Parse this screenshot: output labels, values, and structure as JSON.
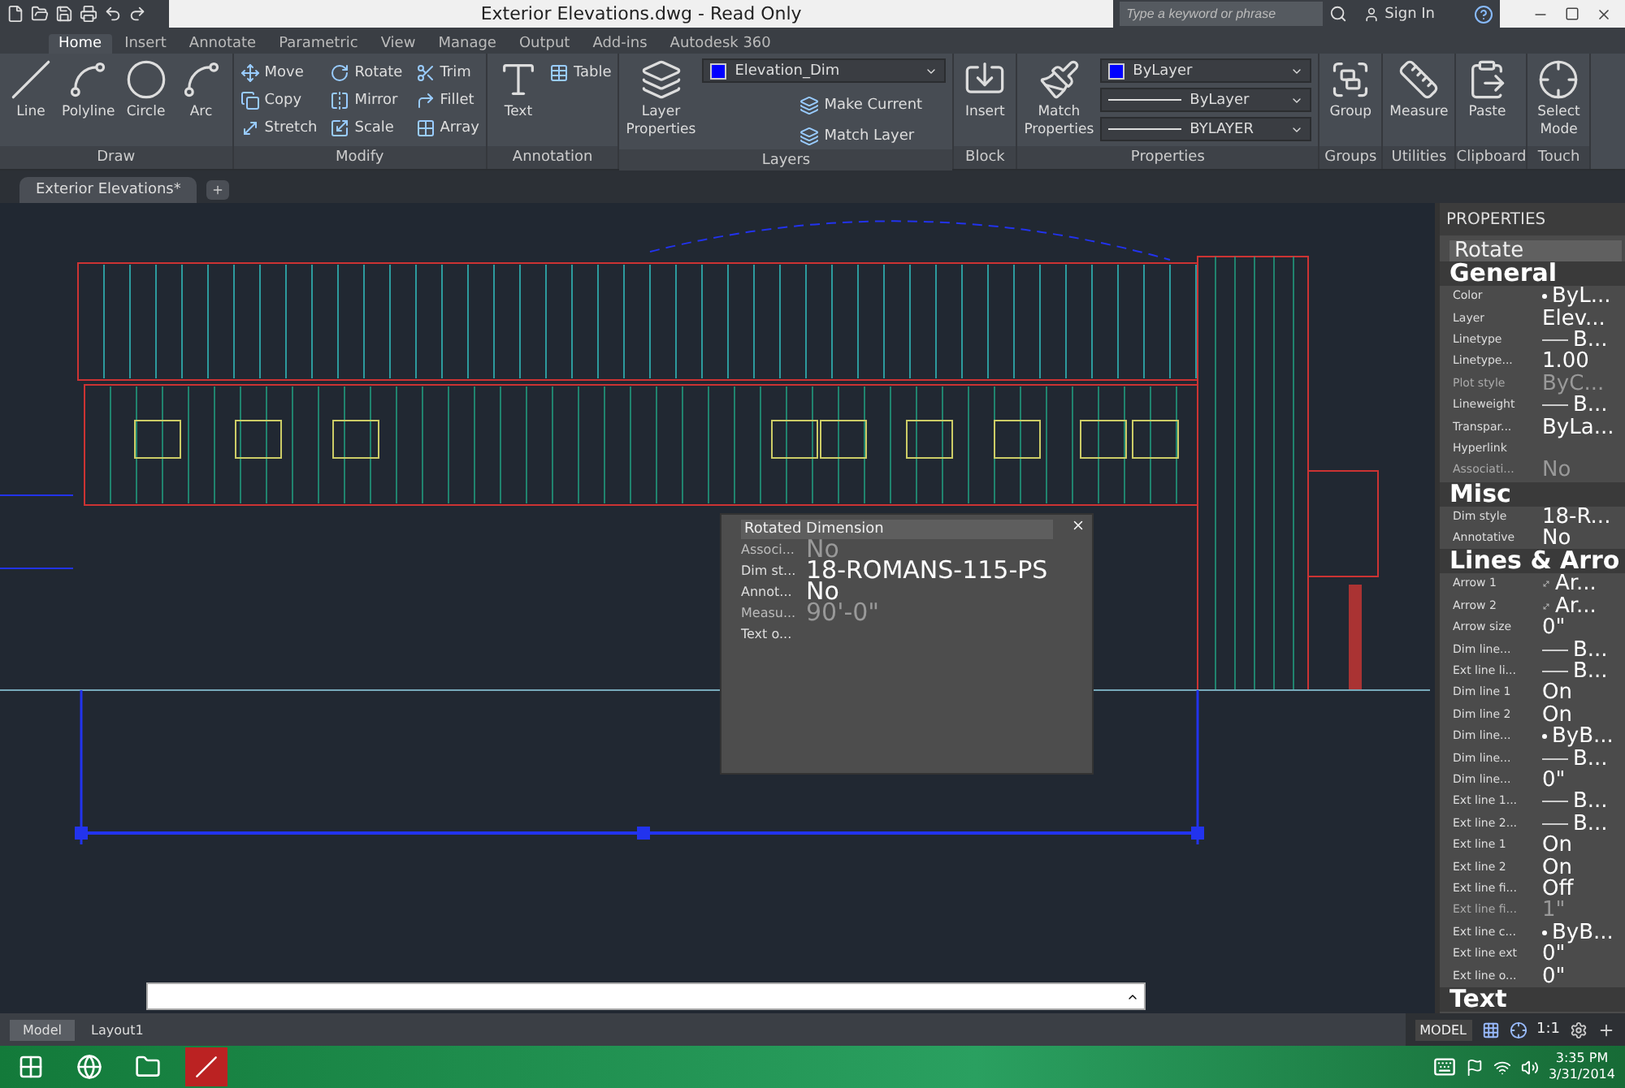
{
  "title_bar": {
    "title": "Exterior Elevations.dwg - Read Only",
    "search_placeholder": "Type a keyword or phrase",
    "sign_in": "Sign In"
  },
  "ribbon_tabs": [
    {
      "label": "Home",
      "selected": true
    },
    {
      "label": "Insert",
      "selected": false
    },
    {
      "label": "Annotate",
      "selected": false
    },
    {
      "label": "Parametric",
      "selected": false
    },
    {
      "label": "View",
      "selected": false
    },
    {
      "label": "Manage",
      "selected": false
    },
    {
      "label": "Output",
      "selected": false
    },
    {
      "label": "Add-ins",
      "selected": false
    },
    {
      "label": "Autodesk 360",
      "selected": false
    }
  ],
  "ribbon_panels": [
    {
      "title": "Draw",
      "tools": [
        {
          "label": "Line",
          "kind": "large"
        },
        {
          "label": "Polyline",
          "kind": "large"
        },
        {
          "label": "Circle",
          "kind": "large"
        },
        {
          "label": "Arc",
          "kind": "large"
        }
      ]
    },
    {
      "title": "Modify",
      "tools": [
        {
          "label": "Move",
          "kind": "small"
        },
        {
          "label": "Copy",
          "kind": "small"
        },
        {
          "label": "Stretch",
          "kind": "small"
        },
        {
          "label": "Rotate",
          "kind": "small"
        },
        {
          "label": "Mirror",
          "kind": "small"
        },
        {
          "label": "Scale",
          "kind": "small"
        },
        {
          "label": "Trim",
          "kind": "small"
        },
        {
          "label": "Fillet",
          "kind": "small"
        },
        {
          "label": "Array",
          "kind": "small"
        }
      ]
    },
    {
      "title": "Annotation",
      "tools": [
        {
          "label": "Text",
          "kind": "large"
        },
        {
          "label": "Table",
          "kind": "small"
        }
      ]
    },
    {
      "title": "Layers",
      "tools": [
        {
          "label": "Layer Properties",
          "kind": "large"
        },
        {
          "label": "Elevation_Dim",
          "kind": "color"
        },
        {
          "label": "Make Current",
          "kind": "small"
        },
        {
          "label": "Match Layer",
          "kind": "small"
        }
      ]
    },
    {
      "title": "Block",
      "tools": [
        {
          "label": "Insert",
          "kind": "large"
        }
      ]
    },
    {
      "title": "Properties",
      "tools": [
        {
          "label": "Match Properties",
          "kind": "large"
        },
        {
          "label": "ByLayer",
          "kind": "color"
        },
        {
          "label": "ByLayer",
          "kind": "line"
        },
        {
          "label": "BYLAYER",
          "kind": "line"
        }
      ]
    },
    {
      "title": "Groups",
      "tools": [
        {
          "label": "Group",
          "kind": "large"
        }
      ]
    },
    {
      "title": "Utilities",
      "tools": [
        {
          "label": "Measure",
          "kind": "large"
        }
      ]
    },
    {
      "title": "Clipboard",
      "tools": [
        {
          "label": "Paste",
          "kind": "large"
        }
      ]
    },
    {
      "title": "Touch",
      "tools": [
        {
          "label": "Select Mode",
          "kind": "large"
        }
      ]
    }
  ],
  "document_tabs": [
    {
      "label": "Exterior Elevations*",
      "selected": true
    }
  ],
  "dimension_dialog": {
    "title": "Rotated Dimension",
    "rows": [
      {
        "label": "Associ...",
        "value": "No",
        "dimmed": true
      },
      {
        "label": "Dim st...",
        "value": "18-ROMANS-115-PS",
        "dimmed": false
      },
      {
        "label": "Annot...",
        "value": "No",
        "dimmed": false
      },
      {
        "label": "Measu...",
        "value": "90'-0\"",
        "dimmed": true
      },
      {
        "label": "Text o...",
        "value": "",
        "dimmed": false
      }
    ]
  },
  "properties_palette": {
    "title": "PROPERTIES",
    "selector": "Rotate",
    "sections": [
      {
        "title": "General",
        "rows": [
          {
            "label": "Color",
            "value": "ByL...",
            "kind": "dot",
            "dimmed": false
          },
          {
            "label": "Layer",
            "value": "Elev...",
            "kind": "plain",
            "dimmed": false
          },
          {
            "label": "Linetype",
            "value": "B...",
            "kind": "line",
            "dimmed": false
          },
          {
            "label": "Linetype...",
            "value": "1.00",
            "kind": "plain",
            "dimmed": false
          },
          {
            "label": "Plot style",
            "value": "ByC...",
            "kind": "plain",
            "dimmed": true
          },
          {
            "label": "Lineweight",
            "value": "B...",
            "kind": "line",
            "dimmed": false
          },
          {
            "label": "Transpar...",
            "value": "ByLa...",
            "kind": "plain",
            "dimmed": false
          },
          {
            "label": "Hyperlink",
            "value": "",
            "kind": "plain",
            "dimmed": false
          },
          {
            "label": "Associati...",
            "value": "No",
            "kind": "plain",
            "dimmed": true
          }
        ]
      },
      {
        "title": "Misc",
        "rows": [
          {
            "label": "Dim style",
            "value": "18-R...",
            "kind": "plain",
            "dimmed": false
          },
          {
            "label": "Annotative",
            "value": "No",
            "kind": "plain",
            "dimmed": false
          }
        ]
      },
      {
        "title": "Lines & Arro",
        "rows": [
          {
            "label": "Arrow 1",
            "value": "Ar...",
            "kind": "arrow",
            "dimmed": false
          },
          {
            "label": "Arrow 2",
            "value": "Ar...",
            "kind": "arrow",
            "dimmed": false
          },
          {
            "label": "Arrow size",
            "value": "0\"",
            "kind": "plain",
            "dimmed": false
          },
          {
            "label": "Dim line...",
            "value": "B...",
            "kind": "line",
            "dimmed": false
          },
          {
            "label": "Ext line li...",
            "value": "B...",
            "kind": "line",
            "dimmed": false
          },
          {
            "label": "Dim line 1",
            "value": "On",
            "kind": "plain",
            "dimmed": false
          },
          {
            "label": "Dim line 2",
            "value": "On",
            "kind": "plain",
            "dimmed": false
          },
          {
            "label": "Dim line...",
            "value": "ByB...",
            "kind": "dot",
            "dimmed": false
          },
          {
            "label": "Dim line...",
            "value": "B...",
            "kind": "line",
            "dimmed": false
          },
          {
            "label": "Dim line...",
            "value": "0\"",
            "kind": "plain",
            "dimmed": false
          },
          {
            "label": "Ext line 1...",
            "value": "B...",
            "kind": "line",
            "dimmed": false
          },
          {
            "label": "Ext line 2...",
            "value": "B...",
            "kind": "line",
            "dimmed": false
          },
          {
            "label": "Ext line 1",
            "value": "On",
            "kind": "plain",
            "dimmed": false
          },
          {
            "label": "Ext line 2",
            "value": "On",
            "kind": "plain",
            "dimmed": false
          },
          {
            "label": "Ext line fi...",
            "value": "Off",
            "kind": "plain",
            "dimmed": false
          },
          {
            "label": "Ext line fi...",
            "value": "1\"",
            "kind": "plain",
            "dimmed": true
          },
          {
            "label": "Ext line c...",
            "value": "ByB...",
            "kind": "dot",
            "dimmed": false
          },
          {
            "label": "Ext line ext",
            "value": "0\"",
            "kind": "plain",
            "dimmed": false
          },
          {
            "label": "Ext line o...",
            "value": "0\"",
            "kind": "plain",
            "dimmed": false
          }
        ]
      },
      {
        "title": "Text"
      }
    ]
  },
  "layout_tabs": [
    {
      "label": "Model",
      "selected": true
    },
    {
      "label": "Layout1",
      "selected": false
    }
  ],
  "status_bar": {
    "mode": "MODEL",
    "scale": "1:1"
  },
  "taskbar": {
    "time": "3:35 PM",
    "date": "3/31/2014"
  }
}
